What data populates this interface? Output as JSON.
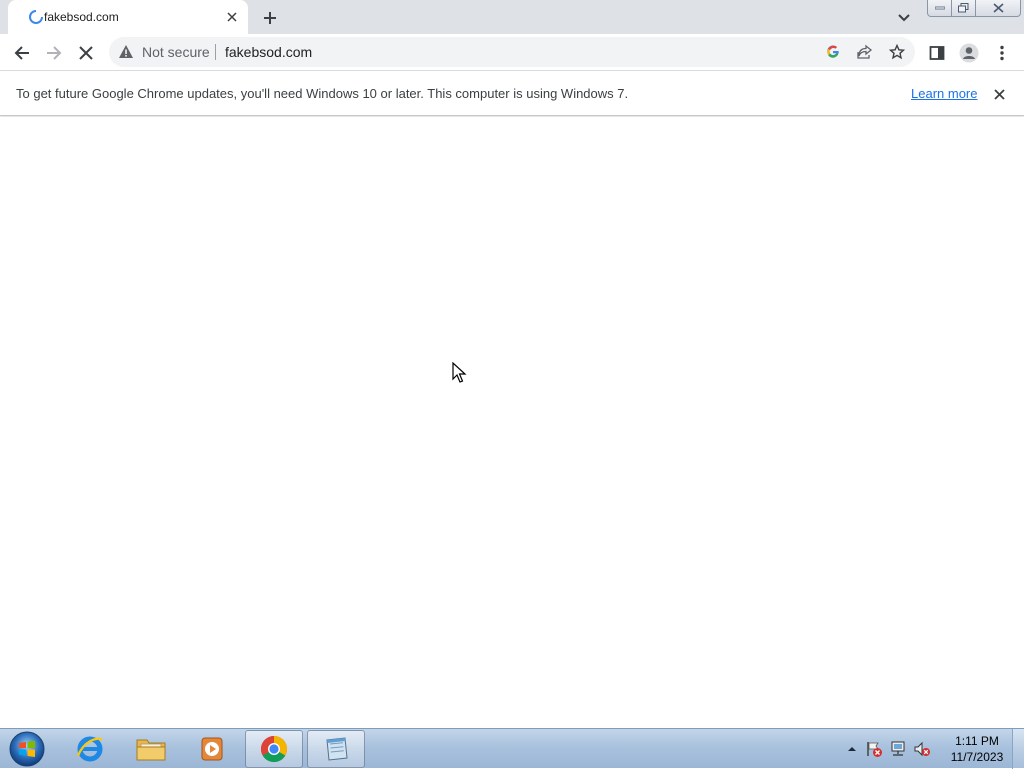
{
  "tab": {
    "title": "fakebsod.com"
  },
  "toolbar": {
    "security_label": "Not secure",
    "url": "fakebsod.com"
  },
  "infobar": {
    "message": "To get future Google Chrome updates, you'll need Windows 10 or later. This computer is using Windows 7.",
    "link_label": "Learn more"
  },
  "taskbar": {
    "apps": [
      "internet-explorer",
      "file-explorer",
      "media-player",
      "chrome",
      "notepad"
    ],
    "active_app": "chrome",
    "clock_time": "1:11 PM",
    "clock_date": "11/7/2023"
  },
  "colors": {
    "tabstrip_bg": "#dee1e6",
    "omnibox_bg": "#f1f3f4",
    "link": "#1a73e8",
    "taskbar": "#a7c0dc"
  }
}
